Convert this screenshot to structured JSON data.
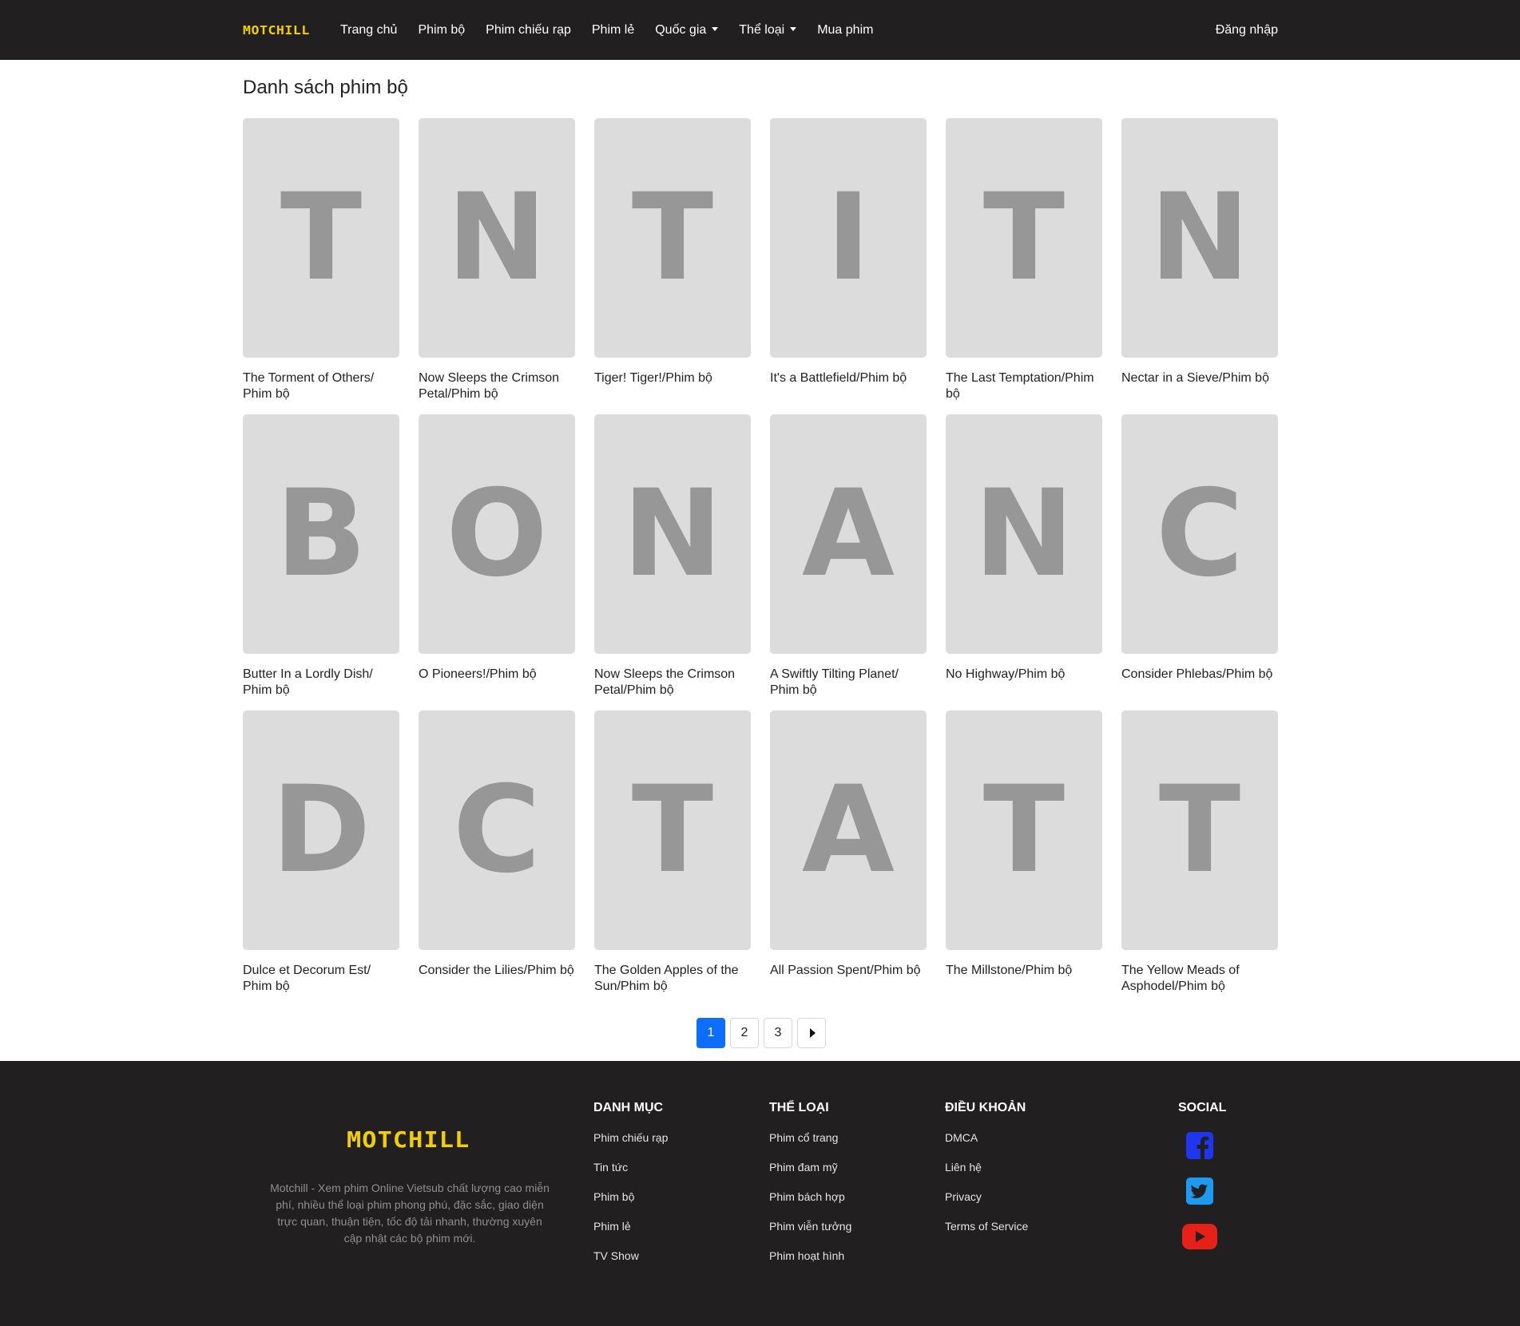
{
  "nav": {
    "logo": "MOTCHILL",
    "links": [
      {
        "label": "Trang chủ",
        "dropdown": false
      },
      {
        "label": "Phim bộ",
        "dropdown": false
      },
      {
        "label": "Phim chiếu rạp",
        "dropdown": false
      },
      {
        "label": "Phim lẻ",
        "dropdown": false
      },
      {
        "label": "Quốc gia",
        "dropdown": true
      },
      {
        "label": "Thể loại",
        "dropdown": true
      },
      {
        "label": "Mua phim",
        "dropdown": false
      }
    ],
    "login": "Đăng nhập"
  },
  "main": {
    "title": "Danh sách phim bộ",
    "movies": [
      {
        "letter": "T",
        "title": "The Torment of Others/ Phim bộ"
      },
      {
        "letter": "N",
        "title": "Now Sleeps the Crimson Petal/Phim bộ"
      },
      {
        "letter": "T",
        "title": "Tiger! Tiger!/Phim bộ"
      },
      {
        "letter": "I",
        "title": "It's a Battlefield/Phim bộ"
      },
      {
        "letter": "T",
        "title": "The Last Temptation/Phim bộ"
      },
      {
        "letter": "N",
        "title": "Nectar in a Sieve/Phim bộ"
      },
      {
        "letter": "B",
        "title": "Butter In a Lordly Dish/ Phim bộ"
      },
      {
        "letter": "O",
        "title": "O Pioneers!/Phim bộ"
      },
      {
        "letter": "N",
        "title": "Now Sleeps the Crimson Petal/Phim bộ"
      },
      {
        "letter": "A",
        "title": "A Swiftly Tilting Planet/ Phim bộ"
      },
      {
        "letter": "N",
        "title": "No Highway/Phim bộ"
      },
      {
        "letter": "C",
        "title": "Consider Phlebas/Phim bộ"
      },
      {
        "letter": "D",
        "title": "Dulce et Decorum Est/ Phim bộ"
      },
      {
        "letter": "C",
        "title": "Consider the Lilies/Phim bộ"
      },
      {
        "letter": "T",
        "title": "The Golden Apples of the Sun/Phim bộ"
      },
      {
        "letter": "A",
        "title": "All Passion Spent/Phim bộ"
      },
      {
        "letter": "T",
        "title": "The Millstone/Phim bộ"
      },
      {
        "letter": "T",
        "title": "The Yellow Meads of Asphodel/Phim bộ"
      }
    ]
  },
  "pagination": {
    "pages": [
      "1",
      "2",
      "3"
    ],
    "current": "1"
  },
  "footer": {
    "logo": "MOTCHILL",
    "description": "Motchill - Xem phim Online Vietsub chất lượng cao miễn phí, nhiều thể loại phim phong phú, đặc sắc, giao diện trực quan, thuận tiện, tốc độ tải nhanh, thường xuyên cập nhật các bộ phim mới.",
    "columns": [
      {
        "heading": "DANH MỤC",
        "items": [
          "Phim chiếu rạp",
          "Tin tức",
          "Phim bộ",
          "Phim lẻ",
          "TV Show"
        ]
      },
      {
        "heading": "THỂ LOẠI",
        "items": [
          "Phim cổ trang",
          "Phim đam mỹ",
          "Phim bách hợp",
          "Phim viễn tưởng",
          "Phim hoạt hình"
        ]
      },
      {
        "heading": "ĐIỀU KHOẢN",
        "items": [
          "DMCA",
          "Liên hệ",
          "Privacy",
          "Terms of Service"
        ]
      }
    ],
    "social_heading": "SOCIAL",
    "social": [
      {
        "icon": "facebook-icon",
        "color": "#1f36f0"
      },
      {
        "icon": "twitter-icon",
        "color": "#1d9bf0"
      },
      {
        "icon": "youtube-icon",
        "color": "#e62117"
      }
    ]
  },
  "colors": {
    "background": "#ffffff",
    "nav_bg": "#211f20",
    "brand_yellow": "#f2d000",
    "poster_bg": "#dcdcdc",
    "poster_letter": "#979797",
    "active_page": "#0d6efd"
  }
}
